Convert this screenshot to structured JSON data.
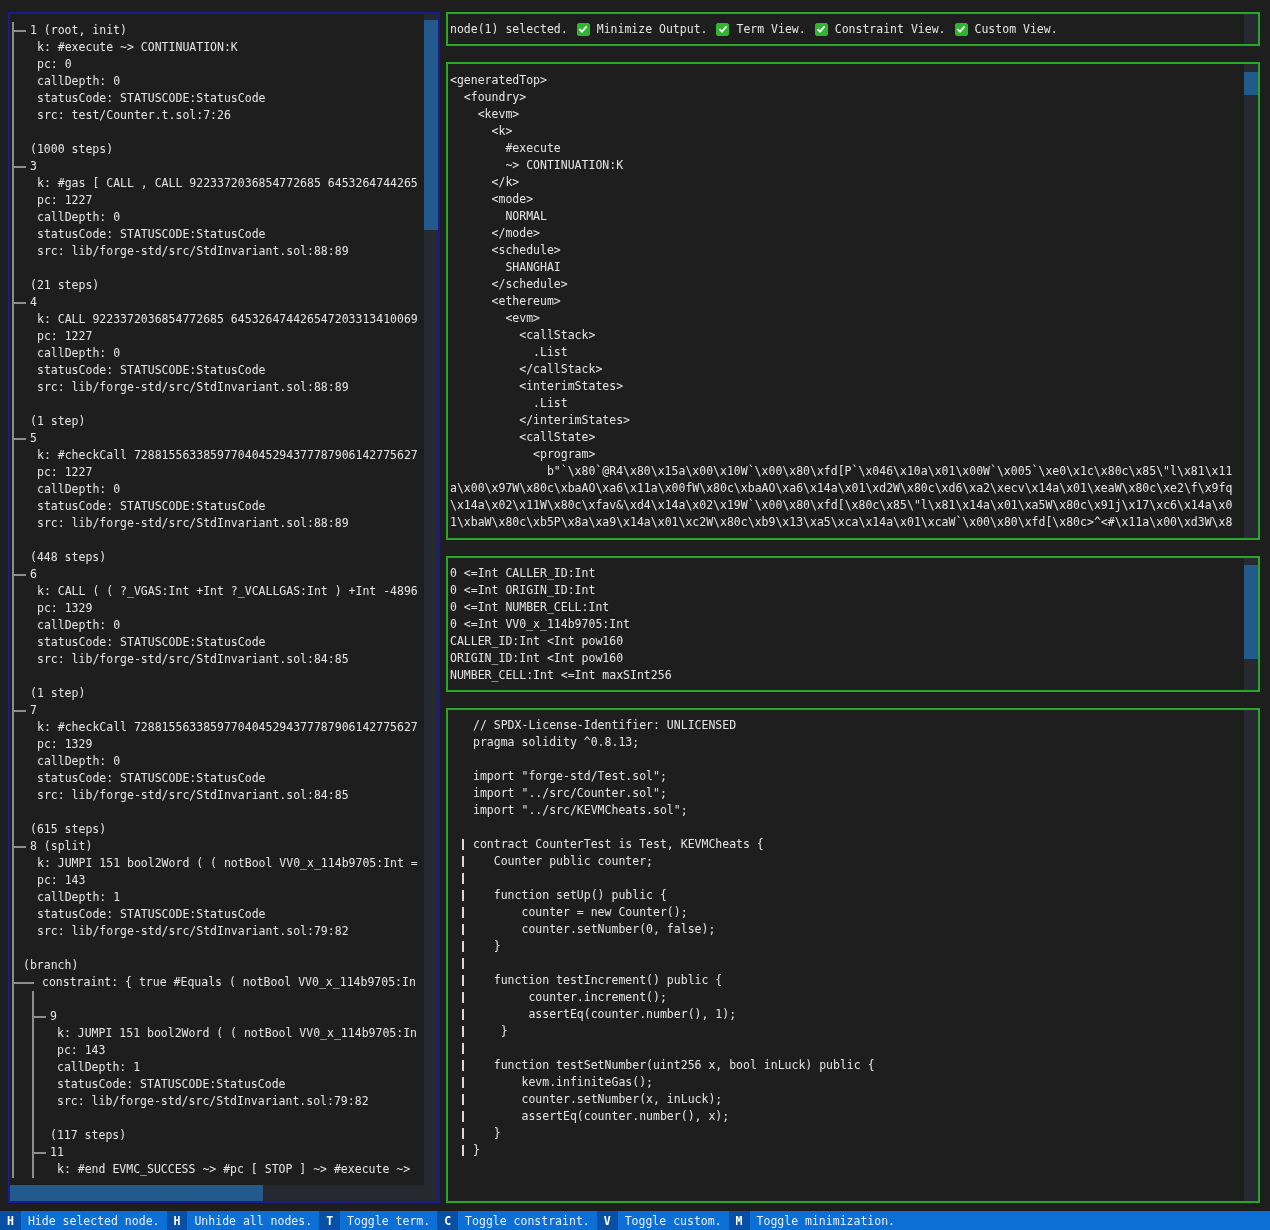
{
  "tree": [
    {
      "kind": "node",
      "label": "1 (root, init)",
      "details": [
        "k: #execute ~> CONTINUATION:K",
        "pc: 0",
        "callDepth: 0",
        "statusCode: STATUSCODE:StatusCode",
        "src: test/Counter.t.sol:7:26"
      ]
    },
    {
      "kind": "steps",
      "label": "(1000 steps)"
    },
    {
      "kind": "node",
      "label": "3",
      "details": [
        "k: #gas [ CALL , CALL 9223372036854772685 6453264744265",
        "pc: 1227",
        "callDepth: 0",
        "statusCode: STATUSCODE:StatusCode",
        "src: lib/forge-std/src/StdInvariant.sol:88:89"
      ]
    },
    {
      "kind": "steps",
      "label": "(21 steps)"
    },
    {
      "kind": "node",
      "label": "4",
      "details": [
        "k: CALL 9223372036854772685 645326474426547203313410069",
        "pc: 1227",
        "callDepth: 0",
        "statusCode: STATUSCODE:StatusCode",
        "src: lib/forge-std/src/StdInvariant.sol:88:89"
      ]
    },
    {
      "kind": "steps",
      "label": "(1 step)"
    },
    {
      "kind": "node",
      "label": "5",
      "details": [
        "k: #checkCall 72881556338597704045294377787906142775627",
        "pc: 1227",
        "callDepth: 0",
        "statusCode: STATUSCODE:StatusCode",
        "src: lib/forge-std/src/StdInvariant.sol:88:89"
      ]
    },
    {
      "kind": "steps",
      "label": "(448 steps)"
    },
    {
      "kind": "node",
      "label": "6",
      "details": [
        "k: CALL ( ( ?_VGAS:Int +Int ?_VCALLGAS:Int ) +Int -4896",
        "pc: 1329",
        "callDepth: 0",
        "statusCode: STATUSCODE:StatusCode",
        "src: lib/forge-std/src/StdInvariant.sol:84:85"
      ]
    },
    {
      "kind": "steps",
      "label": "(1 step)"
    },
    {
      "kind": "node",
      "label": "7",
      "details": [
        "k: #checkCall 72881556338597704045294377787906142775627",
        "pc: 1329",
        "callDepth: 0",
        "statusCode: STATUSCODE:StatusCode",
        "src: lib/forge-std/src/StdInvariant.sol:84:85"
      ]
    },
    {
      "kind": "steps",
      "label": "(615 steps)"
    },
    {
      "kind": "node",
      "label": "8 (split)",
      "details": [
        "k: JUMPI 151 bool2Word ( ( notBool VV0_x_114b9705:Int =",
        "pc: 143",
        "callDepth: 1",
        "statusCode: STATUSCODE:StatusCode",
        "src: lib/forge-std/src/StdInvariant.sol:79:82"
      ]
    },
    {
      "kind": "branch",
      "label": "(branch)",
      "constraint": "constraint: { true #Equals ( notBool VV0_x_114b9705:In",
      "children": [
        {
          "kind": "node",
          "label": "9",
          "details": [
            "k: JUMPI 151 bool2Word ( ( notBool VV0_x_114b9705:In",
            "pc: 143",
            "callDepth: 1",
            "statusCode: STATUSCODE:StatusCode",
            "src: lib/forge-std/src/StdInvariant.sol:79:82"
          ]
        },
        {
          "kind": "steps",
          "label": "(117 steps)"
        },
        {
          "kind": "node",
          "label": "11",
          "details": [
            "k: #end EVMC_SUCCESS ~> #pc [ STOP ] ~> #execute ~>"
          ]
        }
      ]
    }
  ],
  "header": {
    "status": "node(1) selected.",
    "toggles": [
      {
        "label": "Minimize Output.",
        "checked": true
      },
      {
        "label": "Term View.",
        "checked": true
      },
      {
        "label": "Constraint View.",
        "checked": true
      },
      {
        "label": "Custom View.",
        "checked": true
      }
    ]
  },
  "term_view": {
    "lines": [
      {
        "text": "<generatedTop>",
        "children": [
          {
            "text": "<foundry>",
            "children": [
              {
                "text": "<kevm>",
                "children": [
                  {
                    "text": "<k>",
                    "children": [
                      {
                        "text": "#execute"
                      },
                      {
                        "text": "~> CONTINUATION:K"
                      }
                    ]
                  },
                  {
                    "text": "</k>"
                  },
                  {
                    "text": "<mode>",
                    "children": [
                      {
                        "text": "NORMAL"
                      }
                    ]
                  },
                  {
                    "text": "</mode>"
                  },
                  {
                    "text": "<schedule>",
                    "children": [
                      {
                        "text": "SHANGHAI"
                      }
                    ]
                  },
                  {
                    "text": "</schedule>"
                  },
                  {
                    "text": "<ethereum>",
                    "children": [
                      {
                        "text": "<evm>",
                        "children": [
                          {
                            "text": "<callStack>",
                            "children": [
                              {
                                "text": ".List"
                              }
                            ]
                          },
                          {
                            "text": "</callStack>"
                          },
                          {
                            "text": "<interimStates>",
                            "children": [
                              {
                                "text": ".List"
                              }
                            ]
                          },
                          {
                            "text": "</interimStates>"
                          },
                          {
                            "text": "<callState>",
                            "children": [
                              {
                                "text": "<program>",
                                "children": [
                                  {
                                    "text": "b\"`\\x80`@R4\\x80\\x15a\\x00\\x10W`\\x00\\x80\\xfd[P`\\x046\\x10a\\x01\\x00W`\\x005`\\xe0\\x1c\\x80c\\x85\\\"l\\x81\\x11"
                                  }
                                ]
                              }
                            ]
                          }
                        ]
                      }
                    ]
                  }
                ]
              }
            ]
          }
        ]
      }
    ],
    "overflow_lines": [
      "a\\x00\\x97W\\x80c\\xbaAO\\xa6\\x11a\\x00fW\\x80c\\xbaAO\\xa6\\x14a\\x01\\xd2W\\x80c\\xd6\\xa2\\xecv\\x14a\\x01\\xeaW\\x80c\\xe2\\f\\x9fq",
      "\\x14a\\x02\\x11W\\x80c\\xfav&\\xd4\\x14a\\x02\\x19W`\\x00\\x80\\xfd[\\x80c\\x85\\\"l\\x81\\x14a\\x01\\xa5W\\x80c\\x91j\\x17\\xc6\\x14a\\x0",
      "1\\xbaW\\x80c\\xb5P\\x8a\\xa9\\x14a\\x01\\xc2W\\x80c\\xb9\\x13\\xa5\\xca\\x14a\\x01\\xcaW`\\x00\\x80\\xfd[\\x80c>^<#\\x11a\\x00\\xd3W\\x8"
    ]
  },
  "constraint_view": {
    "lines": [
      "0 <=Int CALLER_ID:Int",
      "0 <=Int ORIGIN_ID:Int",
      "0 <=Int NUMBER_CELL:Int",
      "0 <=Int VV0_x_114b9705:Int",
      "CALLER_ID:Int <Int pow160",
      "ORIGIN_ID:Int <Int pow160",
      "NUMBER_CELL:Int <=Int maxSInt256"
    ]
  },
  "custom_view": {
    "lines": [
      {
        "text": "// SPDX-License-Identifier: UNLICENSED",
        "marked": false
      },
      {
        "text": "pragma solidity ^0.8.13;",
        "marked": false
      },
      {
        "marked": false
      },
      {
        "text": "import \"forge-std/Test.sol\";",
        "marked": false
      },
      {
        "text": "import \"../src/Counter.sol\";",
        "marked": false
      },
      {
        "text": "import \"../src/KEVMCheats.sol\";",
        "marked": false
      },
      {
        "marked": false
      },
      {
        "text": "contract CounterTest is Test, KEVMCheats {",
        "marked": true
      },
      {
        "text": "   Counter public counter;",
        "marked": true
      },
      {
        "marked": true
      },
      {
        "text": "   function setUp() public {",
        "marked": true
      },
      {
        "text": "       counter = new Counter();",
        "marked": true
      },
      {
        "text": "       counter.setNumber(0, false);",
        "marked": true
      },
      {
        "text": "   }",
        "marked": true
      },
      {
        "marked": true
      },
      {
        "text": "   function testIncrement() public {",
        "marked": true
      },
      {
        "text": "        counter.increment();",
        "marked": true
      },
      {
        "text": "        assertEq(counter.number(), 1);",
        "marked": true
      },
      {
        "text": "    }",
        "marked": true
      },
      {
        "marked": true
      },
      {
        "text": "   function testSetNumber(uint256 x, bool inLuck) public {",
        "marked": true
      },
      {
        "text": "       kevm.infiniteGas();",
        "marked": true
      },
      {
        "text": "       counter.setNumber(x, inLuck);",
        "marked": true
      },
      {
        "text": "       assertEq(counter.number(), x);",
        "marked": true
      },
      {
        "text": "   }",
        "marked": true
      },
      {
        "text": "}",
        "marked": true
      }
    ]
  },
  "footer": [
    {
      "key": "H",
      "label": "Hide selected node."
    },
    {
      "key": "H",
      "label": "Unhide all nodes."
    },
    {
      "key": "T",
      "label": "Toggle term."
    },
    {
      "key": "C",
      "label": "Toggle constraint."
    },
    {
      "key": "V",
      "label": "Toggle custom."
    },
    {
      "key": "M",
      "label": "Toggle minimization."
    }
  ]
}
